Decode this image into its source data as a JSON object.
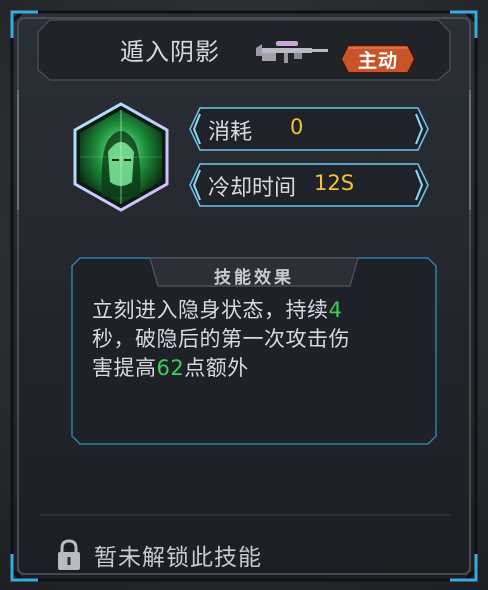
{
  "skill": {
    "name": "遁入阴影",
    "weapon_icon": "sniper-rifle-icon",
    "type_badge": "主动",
    "portrait_icon": "hooded-agent-portrait",
    "stats": {
      "cost_label": "消耗",
      "cost_value": "0",
      "cooldown_label": "冷却时间",
      "cooldown_value": "12S"
    },
    "effect": {
      "title": "技能效果",
      "text_part1": "立刻进入隐身状态，持续",
      "duration": "4",
      "text_part2": "秒，破隐后的第一次攻击伤害提高",
      "bonus": "62",
      "text_part3": "点额外"
    },
    "lock_icon": "padlock-icon",
    "lock_text": "暂未解锁此技能"
  },
  "colors": {
    "value_yellow": "#f4c233",
    "highlight_green": "#38d35a",
    "badge_orange": "#c9542a",
    "frame_blue": "#3aa9e0"
  }
}
